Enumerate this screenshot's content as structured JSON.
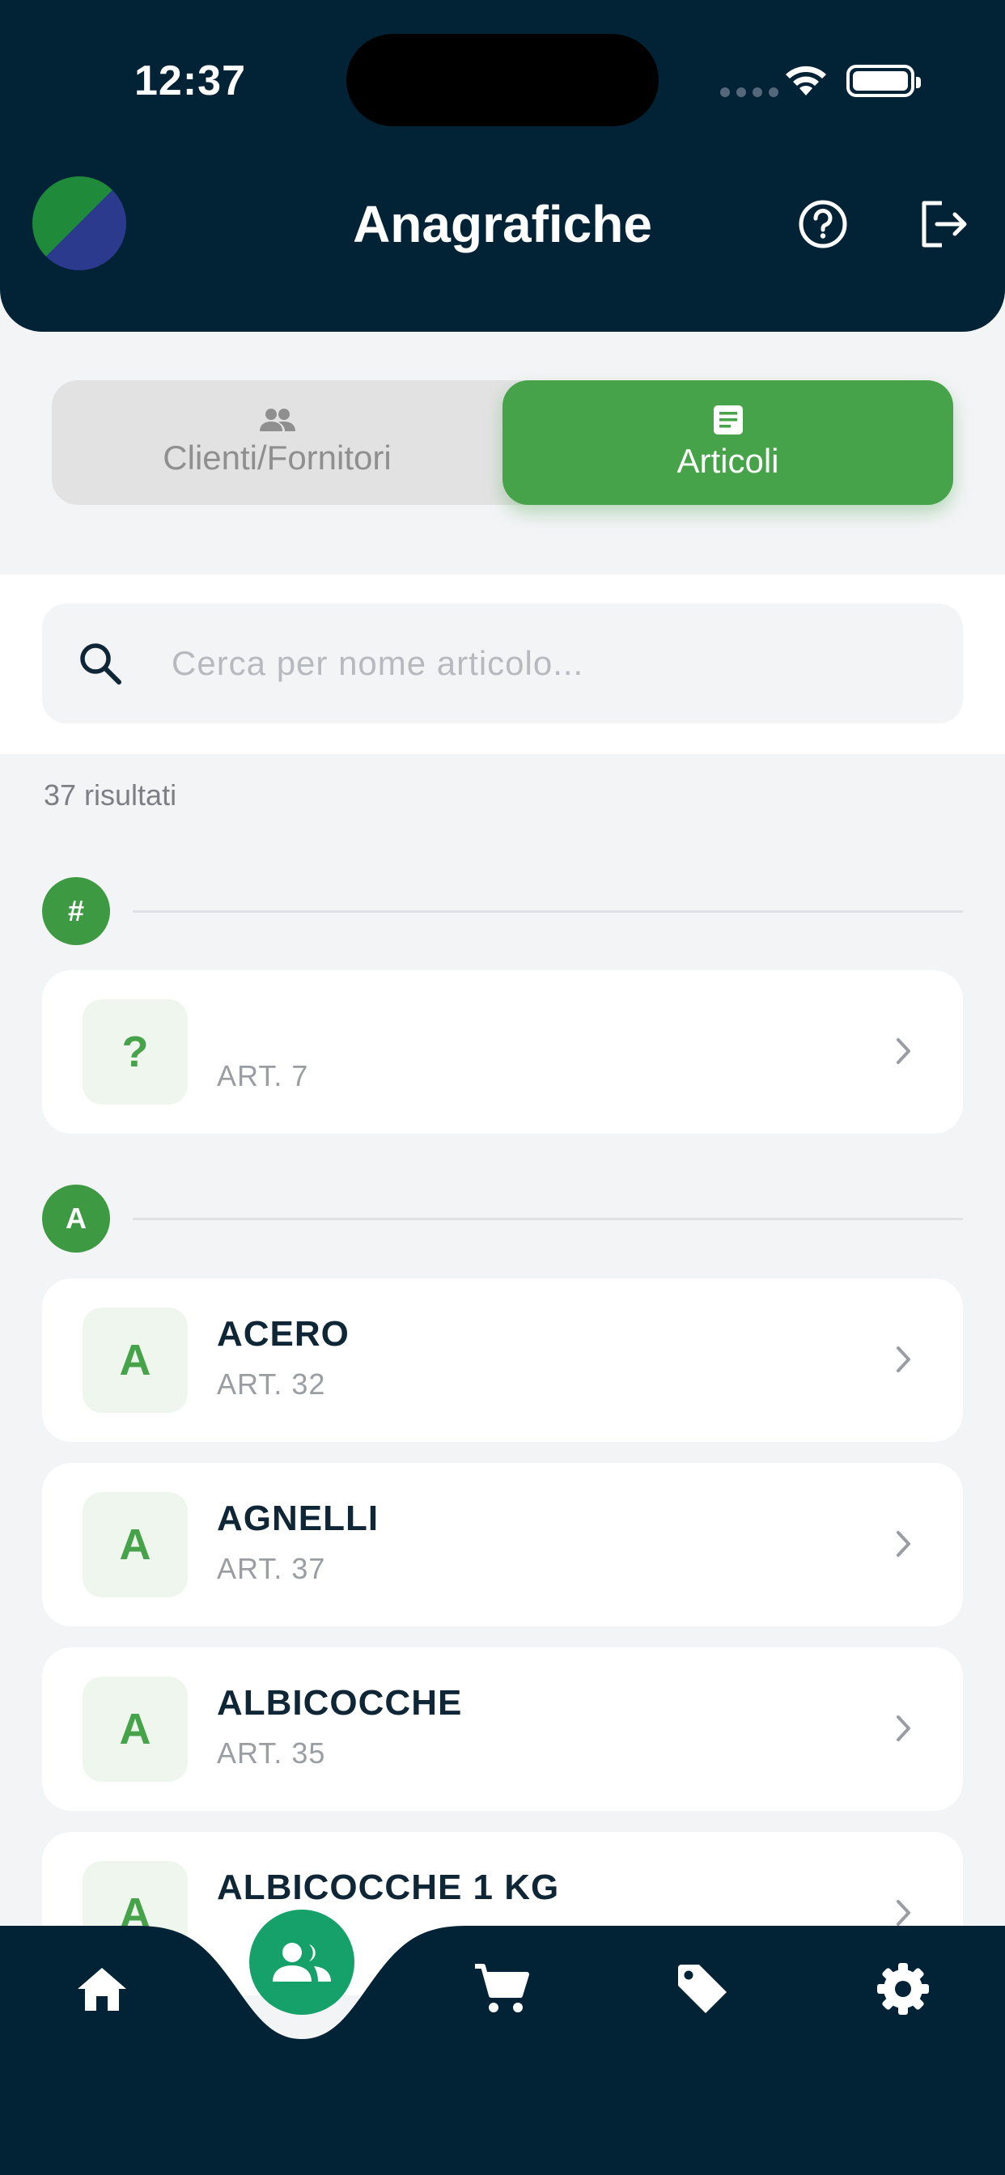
{
  "status_bar": {
    "time": "12:37"
  },
  "header": {
    "title": "Anagrafiche"
  },
  "tabs": [
    {
      "label": "Clienti/Fornitori",
      "icon": "people-icon",
      "active": false
    },
    {
      "label": "Articoli",
      "icon": "article-icon",
      "active": true
    }
  ],
  "search": {
    "placeholder": "Cerca per nome articolo...",
    "value": ""
  },
  "results": {
    "count_text": "37 risultati"
  },
  "sections": [
    {
      "letter": "#",
      "items": [
        {
          "initial": "?",
          "name": "",
          "code": "ART. 7"
        }
      ]
    },
    {
      "letter": "A",
      "items": [
        {
          "initial": "A",
          "name": "ACERO",
          "code": "ART. 32"
        },
        {
          "initial": "A",
          "name": "AGNELLI",
          "code": "ART. 37"
        },
        {
          "initial": "A",
          "name": "ALBICOCCHE",
          "code": "ART. 35"
        },
        {
          "initial": "A",
          "name": "ALBICOCCHE 1 KG",
          "code": ""
        }
      ]
    }
  ],
  "bottom_nav": [
    {
      "icon": "home-icon",
      "active": false
    },
    {
      "icon": "people-icon",
      "active": true
    },
    {
      "icon": "cart-icon",
      "active": false
    },
    {
      "icon": "tag-icon",
      "active": false
    },
    {
      "icon": "settings-icon",
      "active": false
    }
  ],
  "colors": {
    "header_bg": "#022336",
    "accent_green": "#47a34a",
    "fab_green": "#16a16a",
    "page_bg": "#f3f4f6"
  }
}
